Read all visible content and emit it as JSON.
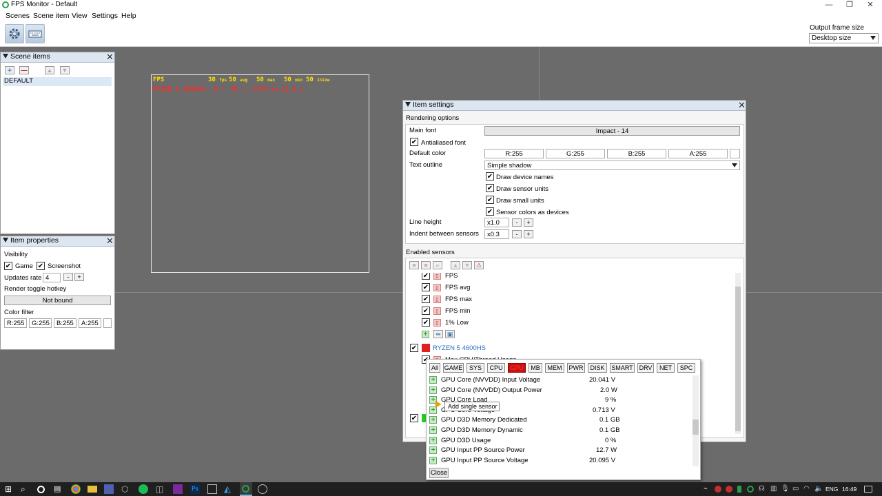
{
  "window": {
    "title": "FPS Monitor - Default"
  },
  "menu": [
    "Scenes",
    "Scene item",
    "View",
    "Settings",
    "Help"
  ],
  "toolbar": {
    "icons": [
      "gear-icon",
      "keyboard-icon"
    ],
    "output_frame_size_label": "Output frame size",
    "output_frame_size_value": "Desktop size"
  },
  "overlay": {
    "row1": {
      "name": "FPS",
      "vals": [
        [
          "30",
          "fps"
        ],
        [
          "50",
          "avg"
        ],
        [
          "50",
          "max"
        ],
        [
          "50",
          "min"
        ],
        [
          "50",
          "1%low"
        ]
      ],
      "color": "#ffe000"
    },
    "row2": {
      "name": "RYZEN 5 4600HS",
      "vals": [
        [
          "8",
          "%"
        ],
        [
          "45",
          "°C"
        ],
        [
          "1774",
          "MHz"
        ],
        [
          "11.5",
          "W"
        ]
      ],
      "color": "#ff2a2a"
    }
  },
  "scene_items": {
    "title": "Scene items",
    "items": [
      "DEFAULT"
    ]
  },
  "item_properties": {
    "title": "Item properties",
    "visibility_label": "Visibility",
    "game_label": "Game",
    "screenshot_label": "Screenshot",
    "updates_rate_label": "Updates rate",
    "updates_rate_value": "4",
    "hotkey_label": "Render toggle hotkey",
    "hotkey_value": "Not bound",
    "color_filter_label": "Color filter",
    "color_filter": [
      "R:255",
      "G:255",
      "B:255",
      "A:255"
    ]
  },
  "item_settings": {
    "title": "Item settings",
    "rendering_options": "Rendering options",
    "main_font_label": "Main font",
    "main_font_value": "Impact - 14",
    "antialiased_label": "Antialiased font",
    "default_color_label": "Default color",
    "default_color": [
      "R:255",
      "G:255",
      "B:255",
      "A:255"
    ],
    "text_outline_label": "Text outline",
    "text_outline_value": "Simple shadow",
    "options": [
      "Draw device names",
      "Draw sensor units",
      "Draw small units",
      "Sensor colors as devices"
    ],
    "line_height_label": "Line height",
    "line_height_value": "x1.0",
    "indent_label": "Indent between sensors",
    "indent_value": "x0.3",
    "enabled_sensors_label": "Enabled sensors",
    "fps_sensors": [
      "FPS",
      "FPS avg",
      "FPS max",
      "FPS min",
      "1% Low"
    ],
    "device_name": "RYZEN 5 4600HS",
    "device_color": "#e02020",
    "device_sensor": "Max CPU/Thread Usage",
    "second_device_color": "#22cc22"
  },
  "sensor_popup": {
    "categories": [
      "All",
      "GAME",
      "SYS",
      "CPU",
      "GPU",
      "MB",
      "MEM",
      "PWR",
      "DISK",
      "SMART",
      "DRV",
      "NET",
      "SPC"
    ],
    "active_category": "GPU",
    "items": [
      {
        "name": "GPU Core (NVVDD) Input Voltage",
        "value": "20.041 V"
      },
      {
        "name": "GPU Core (NVVDD) Output Power",
        "value": "2.0 W"
      },
      {
        "name": "GPU Core Load",
        "value": "9 %"
      },
      {
        "name": "GPU Core Voltage",
        "value": "0.713 V"
      },
      {
        "name": "GPU D3D Memory Dedicated",
        "value": "0.1 GB"
      },
      {
        "name": "GPU D3D Memory Dynamic",
        "value": "0.1 GB"
      },
      {
        "name": "GPU D3D Usage",
        "value": "0 %"
      },
      {
        "name": "GPU Input PP Source Power",
        "value": "12.7 W"
      },
      {
        "name": "GPU Input PP Source Voltage",
        "value": "20.095 V"
      }
    ],
    "tooltip": "Add single sensor",
    "close_label": "Close"
  },
  "taskbar": {
    "language": "ENG",
    "time": "16:49"
  }
}
